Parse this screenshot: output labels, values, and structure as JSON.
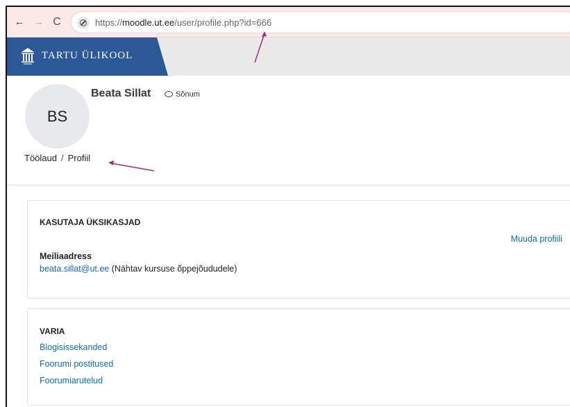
{
  "browser": {
    "url_prefix": "https://",
    "url_domain": "moodle.ut.ee",
    "url_path": "/user/profile.php?id=666",
    "back_icon": "←",
    "forward_icon": "→",
    "reload_icon": "C"
  },
  "brand": {
    "name": "TARTU ÜLIKOOL"
  },
  "profile": {
    "initials": "BS",
    "name": "Beata Sillat",
    "message_label": "Sõnum"
  },
  "breadcrumb": {
    "items": [
      "Töölaud",
      "Profiil"
    ],
    "separator": "/"
  },
  "user_details": {
    "title": "KASUTAJA ÜKSIKASJAD",
    "edit_label": "Muuda profiili",
    "email_label": "Meiliaadress",
    "email": "beata.sillat@ut.ee",
    "email_visibility": "(Nähtav kursuse õppejõududele)"
  },
  "misc": {
    "title": "VARIA",
    "links": [
      "Blogisissekanded",
      "Foorumi postitused",
      "Foorumiarutelud"
    ]
  },
  "colors": {
    "brand_blue": "#2c5898",
    "link_blue": "#0f6cbf",
    "annotation": "#a0307a"
  }
}
